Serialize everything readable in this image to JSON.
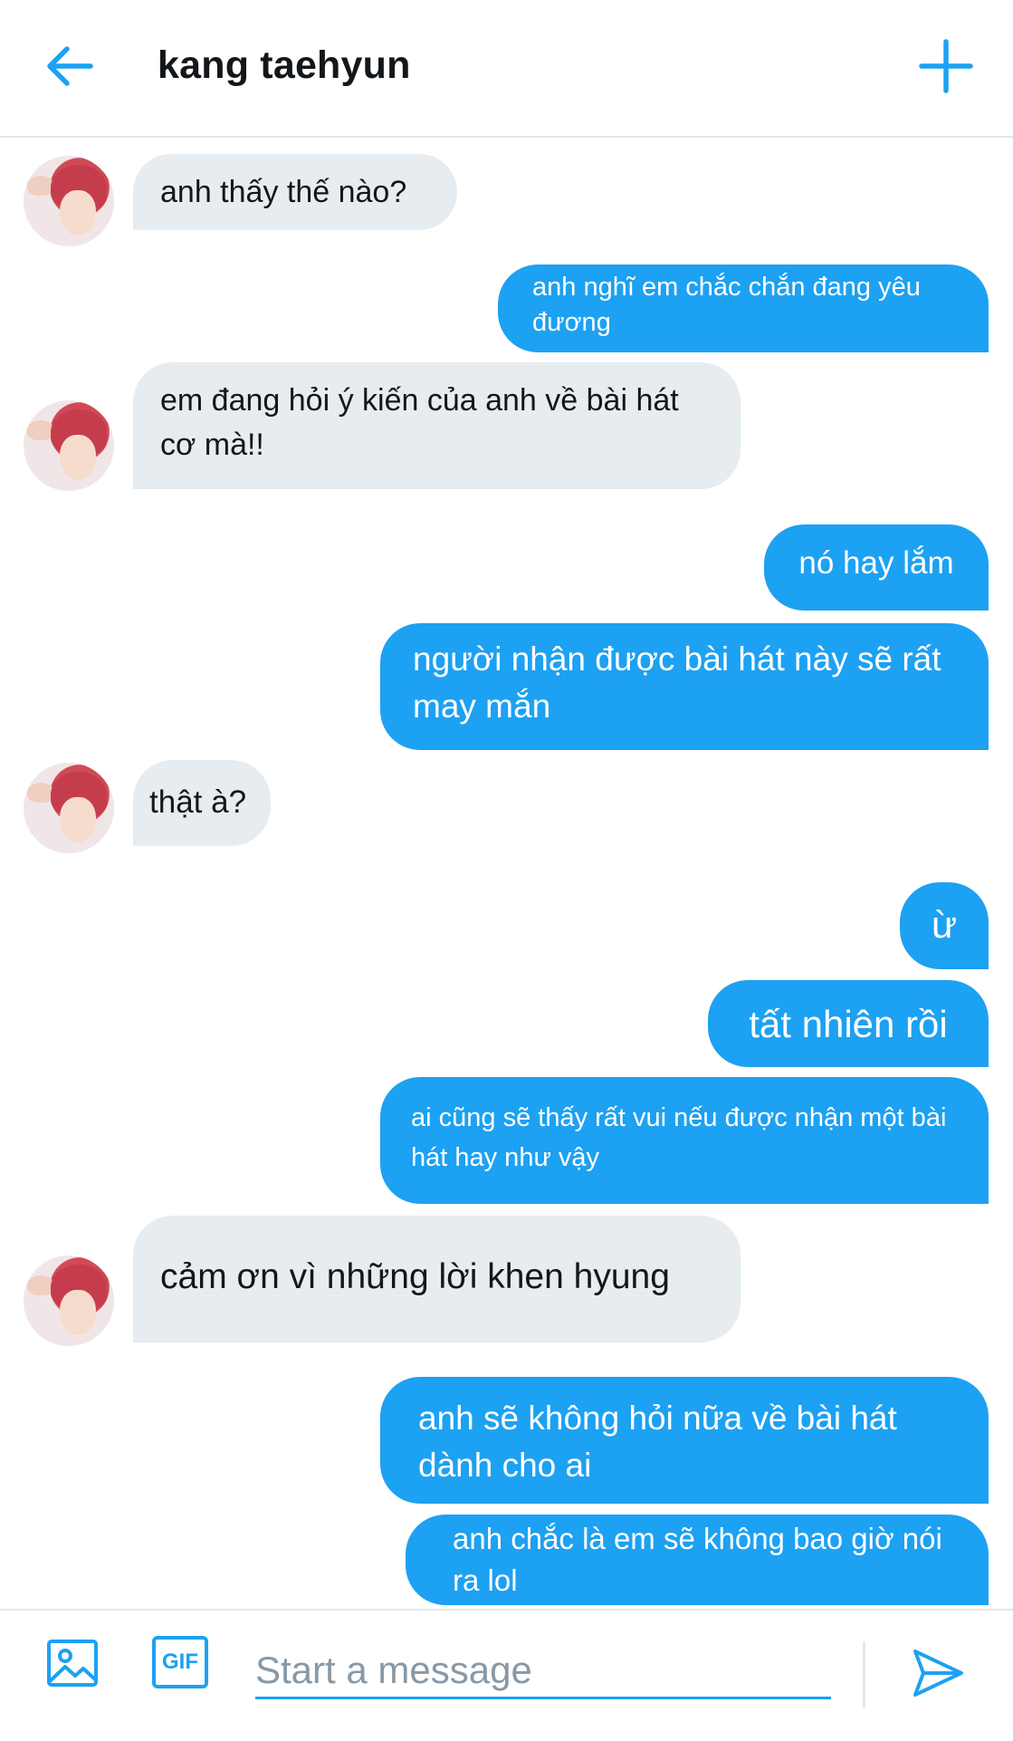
{
  "header": {
    "title": "kang taehyun",
    "back_icon": "arrow-left-icon",
    "new_icon": "plus-icon"
  },
  "messages": [
    {
      "from": "them",
      "text": "anh thấy thế nào?"
    },
    {
      "from": "me",
      "text": "anh nghĩ em chắc chắn đang yêu đương"
    },
    {
      "from": "them",
      "text": "em đang hỏi ý kiến của anh về bài hát cơ mà!!"
    },
    {
      "from": "me",
      "text": "nó hay lắm"
    },
    {
      "from": "me",
      "text": "người nhận được bài hát này sẽ rất may mắn"
    },
    {
      "from": "them",
      "text": "thật à?"
    },
    {
      "from": "me",
      "text": "ừ"
    },
    {
      "from": "me",
      "text": "tất nhiên rồi"
    },
    {
      "from": "me",
      "text": "ai cũng sẽ thấy rất vui nếu được nhận một bài hát hay như vậy"
    },
    {
      "from": "them",
      "text": "cảm ơn vì những lời khen hyung"
    },
    {
      "from": "me",
      "text": "anh sẽ không hỏi nữa về bài hát dành cho ai"
    },
    {
      "from": "me",
      "text": "anh chắc là em sẽ không bao giờ nói ra lol"
    }
  ],
  "composer": {
    "placeholder": "Start a message",
    "gif_label": "GIF",
    "image_icon": "image-icon",
    "send_icon": "send-icon"
  },
  "colors": {
    "accent": "#1da1f2",
    "incoming_bubble": "#e6ecf0",
    "text": "#14171a",
    "muted": "#8899a6"
  }
}
